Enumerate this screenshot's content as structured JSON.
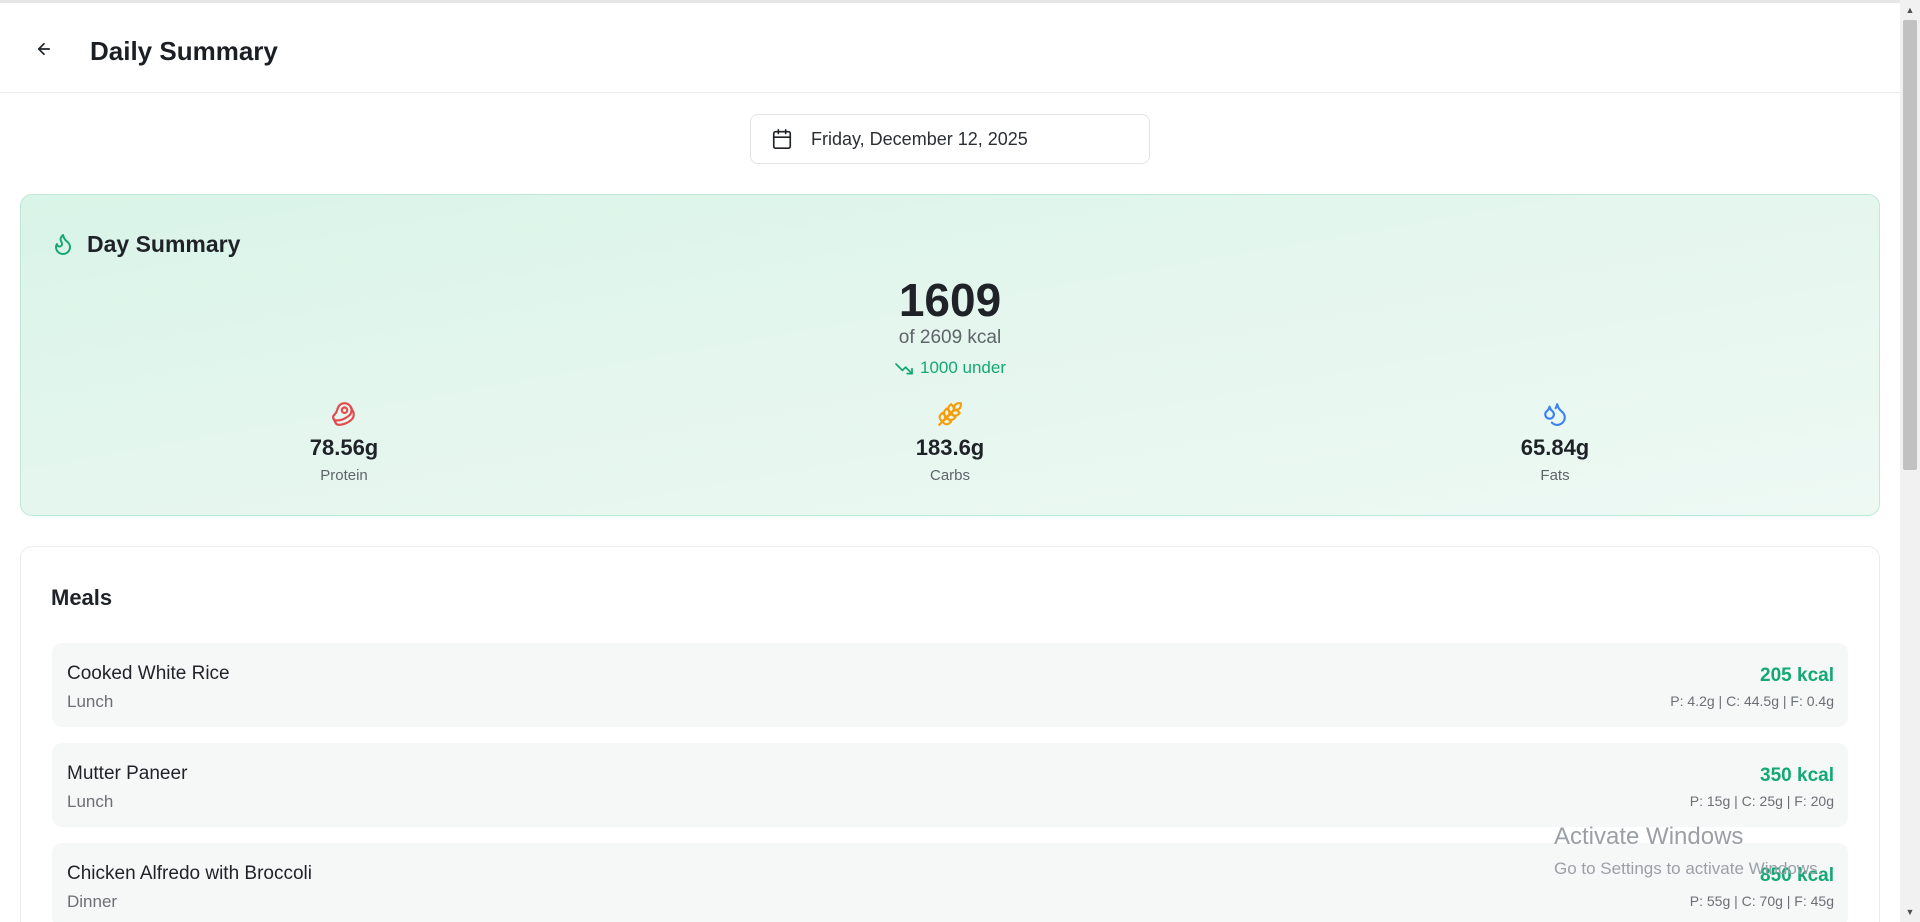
{
  "header": {
    "title": "Daily Summary",
    "back_icon": "arrow-left-icon"
  },
  "date_picker": {
    "value": "Friday, December 12, 2025",
    "icon": "calendar-icon"
  },
  "day_summary": {
    "title": "Day Summary",
    "icon": "flame-icon",
    "calories": "1609",
    "goal_text": "of 2609 kcal",
    "delta_text": "1000 under",
    "macros": [
      {
        "key": "protein",
        "value": "78.56g",
        "label": "Protein",
        "icon": "beef-icon",
        "color": "#e5484d"
      },
      {
        "key": "carbs",
        "value": "183.6g",
        "label": "Carbs",
        "icon": "wheat-icon",
        "color": "#f59e0b"
      },
      {
        "key": "fats",
        "value": "65.84g",
        "label": "Fats",
        "icon": "droplets-icon",
        "color": "#3b82f6"
      }
    ]
  },
  "meals": {
    "title": "Meals",
    "items": [
      {
        "name": "Cooked White Rice",
        "type": "Lunch",
        "kcal": "205 kcal",
        "macros": "P: 4.2g | C: 44.5g | F: 0.4g"
      },
      {
        "name": "Mutter Paneer",
        "type": "Lunch",
        "kcal": "350 kcal",
        "macros": "P: 15g | C: 25g | F: 20g"
      },
      {
        "name": "Chicken Alfredo with Broccoli",
        "type": "Dinner",
        "kcal": "850 kcal",
        "macros": "P: 55g | C: 70g | F: 45g"
      }
    ]
  },
  "watermark": {
    "title": "Activate Windows",
    "subtitle": "Go to Settings to activate Windows."
  },
  "colors": {
    "accent": "#14a874",
    "summary_bg": "#e4f6ee",
    "summary_border": "#bfe9d6"
  }
}
